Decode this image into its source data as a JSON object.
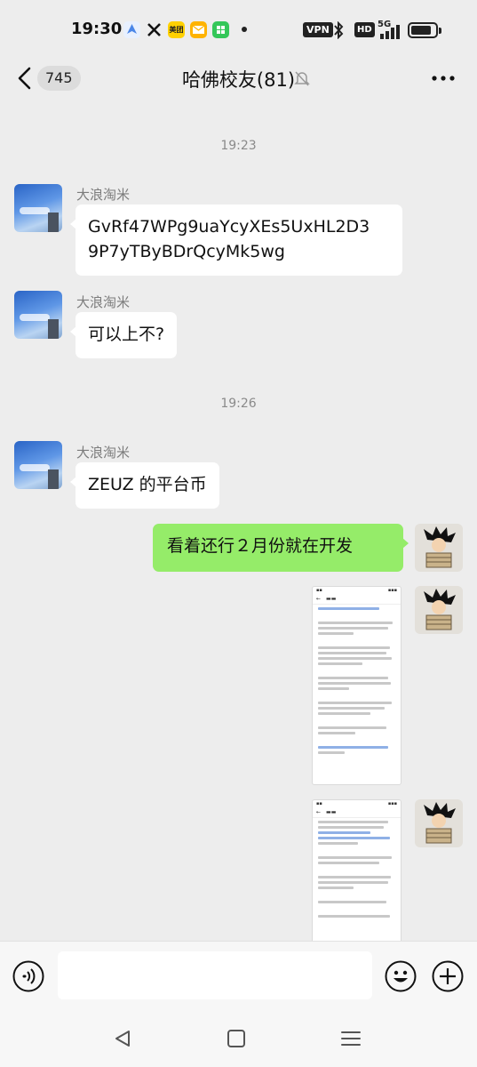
{
  "status_bar": {
    "time": "19:30",
    "app_icons": [
      {
        "name": "maps-icon",
        "color": "#4a86e8"
      },
      {
        "name": "x-icon",
        "color": "#111111"
      },
      {
        "name": "meituan-icon",
        "color": "#ffd100",
        "label": "美团"
      },
      {
        "name": "mail-icon",
        "color": "#ffb300"
      },
      {
        "name": "app-grid-icon",
        "color": "#34c759"
      }
    ],
    "vpn": "VPN",
    "hd": "HD",
    "network": "5G",
    "battery_level": 0.85
  },
  "header": {
    "unread_count": "745",
    "title": "哈佛校友(81)",
    "muted_icon": "bell-muted-icon",
    "more_icon": "more-icon"
  },
  "messages": {
    "time1": "19:23",
    "time2": "19:26",
    "sender": "大浪淘米",
    "msg1_line1": "GvRf47WPg9uaYcyXEs5UxHL2D3",
    "msg1_line2": "9P7yTByBDrQcyMk5wg",
    "msg2": "可以上不?",
    "msg3": "ZEUZ 的平台币",
    "msg4": "看着还行２月份就在开发"
  },
  "colors": {
    "my_bubble": "#95ec69",
    "their_bubble": "#ffffff",
    "background": "#ededed"
  },
  "input_bar": {
    "voice_icon": "voice-icon",
    "emoji_icon": "emoji-icon",
    "plus_icon": "plus-icon",
    "value": ""
  },
  "navbar": {
    "back_icon": "nav-back-icon",
    "home_icon": "nav-home-icon",
    "menu_icon": "nav-menu-icon"
  }
}
